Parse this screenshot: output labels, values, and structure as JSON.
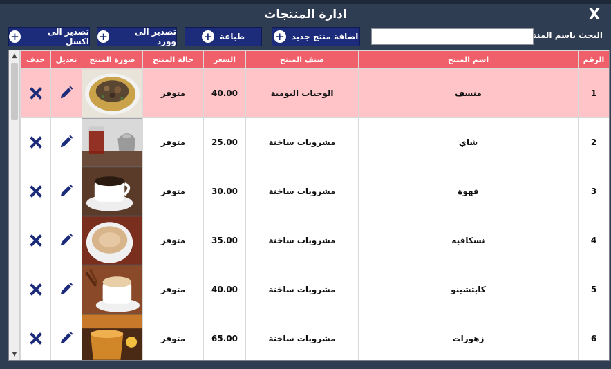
{
  "window": {
    "title": "ادارة المنتجات",
    "close_label": "X"
  },
  "toolbar": {
    "search_label": "البحث باسم المنتج",
    "search_value": "",
    "add_label": "اضافة منتج جديد",
    "print_label": "طباعة",
    "word_label": "تصدير الى وورد",
    "excel_label": "تصدير الى اكسل"
  },
  "table": {
    "headers": {
      "id": "الرقم",
      "name": "اسم المنتج",
      "category": "صنف المنتج",
      "price": "السعر",
      "status": "حالة المنتج",
      "image": "صورة المنتج",
      "edit": "تعديل",
      "delete": "حذف"
    },
    "rows": [
      {
        "id": "1",
        "name": "منسف",
        "category": "الوجبات اليومية",
        "price": "40.00",
        "status": "متوفر",
        "image": "mansaf-photo",
        "selected": true
      },
      {
        "id": "2",
        "name": "شاي",
        "category": "مشروبات ساخنة",
        "price": "25.00",
        "status": "متوفر",
        "image": "tea-photo"
      },
      {
        "id": "3",
        "name": "قهوة",
        "category": "مشروبات ساخنة",
        "price": "30.00",
        "status": "متوفر",
        "image": "coffee-photo"
      },
      {
        "id": "4",
        "name": "نسكافيه",
        "category": "مشروبات ساخنة",
        "price": "35.00",
        "status": "متوفر",
        "image": "nescafe-photo"
      },
      {
        "id": "5",
        "name": "كابتشينو",
        "category": "مشروبات ساخنة",
        "price": "40.00",
        "status": "متوفر",
        "image": "cappuccino-photo"
      },
      {
        "id": "6",
        "name": "زهورات",
        "category": "مشروبات ساخنة",
        "price": "65.00",
        "status": "متوفر",
        "image": "herbal-tea-photo"
      }
    ]
  },
  "icons": {
    "edit": "pencil-icon",
    "delete": "close-x-icon",
    "add": "plus-circle-icon"
  },
  "colors": {
    "window_bg": "#2f3d52",
    "button_bg": "#1c2c7a",
    "header_bg": "#f0606a",
    "selected_row": "#ffc4c7",
    "icon_color": "#1c2c7a"
  }
}
